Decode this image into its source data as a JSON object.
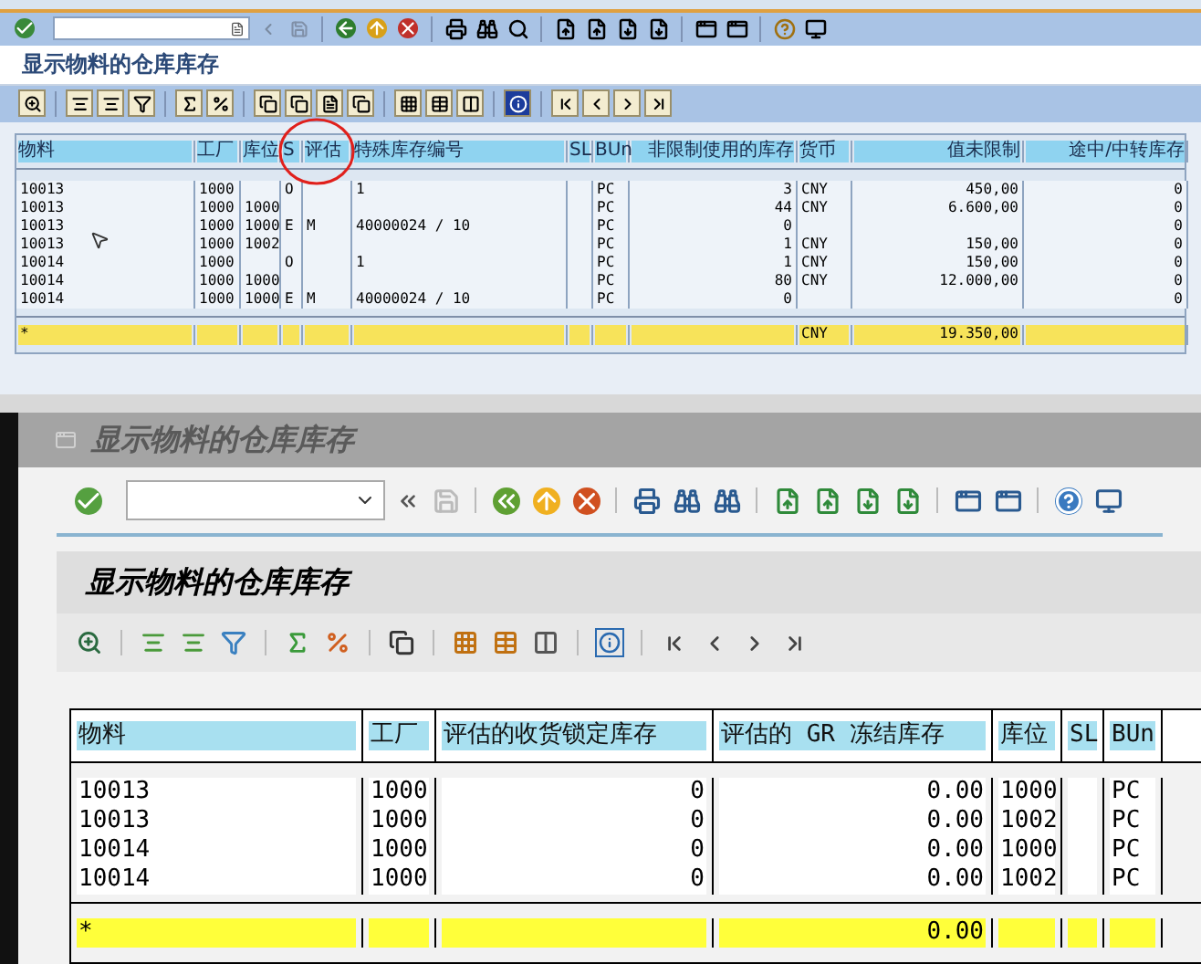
{
  "top_window": {
    "title": "显示物料的仓库库存",
    "table": {
      "columns": [
        {
          "label": "物料"
        },
        {
          "label": "工厂"
        },
        {
          "label": "库位"
        },
        {
          "label": "S"
        },
        {
          "label": "评估"
        },
        {
          "label": "特殊库存编号"
        },
        {
          "label": "SL"
        },
        {
          "label": "BUn"
        },
        {
          "label": "非限制使用的库存"
        },
        {
          "label": "货币"
        },
        {
          "label": "值未限制"
        },
        {
          "label": "途中/中转库存"
        }
      ],
      "rows": [
        [
          {
            "text": "10013"
          },
          {
            "text": "1000"
          },
          {},
          {
            "text": "O"
          },
          {},
          {
            "text": "1"
          },
          {},
          {
            "text": "PC"
          },
          {
            "text": "3"
          },
          {
            "text": "CNY"
          },
          {
            "text": "450,00"
          },
          {
            "text": "0"
          }
        ],
        [
          {
            "text": "10013"
          },
          {
            "text": "1000"
          },
          {
            "text": "1000"
          },
          {},
          {},
          {},
          {},
          {
            "text": "PC"
          },
          {
            "text": "44"
          },
          {
            "text": "CNY"
          },
          {
            "text": "6.600,00"
          },
          {
            "text": "0"
          }
        ],
        [
          {
            "text": "10013"
          },
          {
            "text": "1000"
          },
          {
            "text": "1000"
          },
          {
            "text": "E"
          },
          {
            "text": "M"
          },
          {
            "text": "40000024 / 10"
          },
          {},
          {
            "text": "PC"
          },
          {
            "text": "0"
          },
          {},
          {},
          {
            "text": "0"
          }
        ],
        [
          {
            "text": "10013"
          },
          {
            "text": "1000"
          },
          {
            "text": "1002"
          },
          {},
          {},
          {},
          {},
          {
            "text": "PC"
          },
          {
            "text": "1"
          },
          {
            "text": "CNY"
          },
          {
            "text": "150,00"
          },
          {
            "text": "0"
          }
        ],
        [
          {
            "text": "10014"
          },
          {
            "text": "1000"
          },
          {},
          {
            "text": "O"
          },
          {},
          {
            "text": "1"
          },
          {},
          {
            "text": "PC"
          },
          {
            "text": "1"
          },
          {
            "text": "CNY"
          },
          {
            "text": "150,00"
          },
          {
            "text": "0"
          }
        ],
        [
          {
            "text": "10014"
          },
          {
            "text": "1000"
          },
          {
            "text": "1000"
          },
          {},
          {},
          {},
          {},
          {
            "text": "PC"
          },
          {
            "text": "80"
          },
          {
            "text": "CNY"
          },
          {
            "text": "12.000,00"
          },
          {
            "text": "0"
          }
        ],
        [
          {
            "text": "10014"
          },
          {
            "text": "1000"
          },
          {
            "text": "1000"
          },
          {
            "text": "E"
          },
          {
            "text": "M"
          },
          {
            "text": "40000024 / 10"
          },
          {},
          {
            "text": "PC"
          },
          {
            "text": "0"
          },
          {},
          {},
          {
            "text": "0"
          }
        ]
      ],
      "total_row": {
        "marker": "*",
        "currency": "CNY",
        "value": "19.350,00"
      }
    }
  },
  "bottom_window": {
    "window_title": "显示物料的仓库库存",
    "title": "显示物料的仓库库存",
    "table": {
      "columns": [
        {
          "label": "物料"
        },
        {
          "label": "工厂"
        },
        {
          "label": "评估的收货锁定库存"
        },
        {
          "label": "评估的 GR 冻结库存"
        },
        {
          "label": "库位"
        },
        {
          "label": "SL"
        },
        {
          "label": "BUn"
        }
      ],
      "rows": [
        [
          {
            "text": "10013"
          },
          {
            "text": "1000"
          },
          {
            "text": "0"
          },
          {
            "text": "0.00"
          },
          {
            "text": "1000"
          },
          {},
          {
            "text": "PC"
          }
        ],
        [
          {
            "text": "10013"
          },
          {
            "text": "1000"
          },
          {
            "text": "0"
          },
          {
            "text": "0.00"
          },
          {
            "text": "1002"
          },
          {},
          {
            "text": "PC"
          }
        ],
        [
          {
            "text": "10014"
          },
          {
            "text": "1000"
          },
          {
            "text": "0"
          },
          {
            "text": "0.00"
          },
          {
            "text": "1000"
          },
          {},
          {
            "text": "PC"
          }
        ],
        [
          {
            "text": "10014"
          },
          {
            "text": "1000"
          },
          {
            "text": "0"
          },
          {
            "text": "0.00"
          },
          {
            "text": "1002"
          },
          {},
          {
            "text": "PC"
          }
        ]
      ],
      "total_row": {
        "marker": "*",
        "value": "0.00"
      }
    }
  }
}
